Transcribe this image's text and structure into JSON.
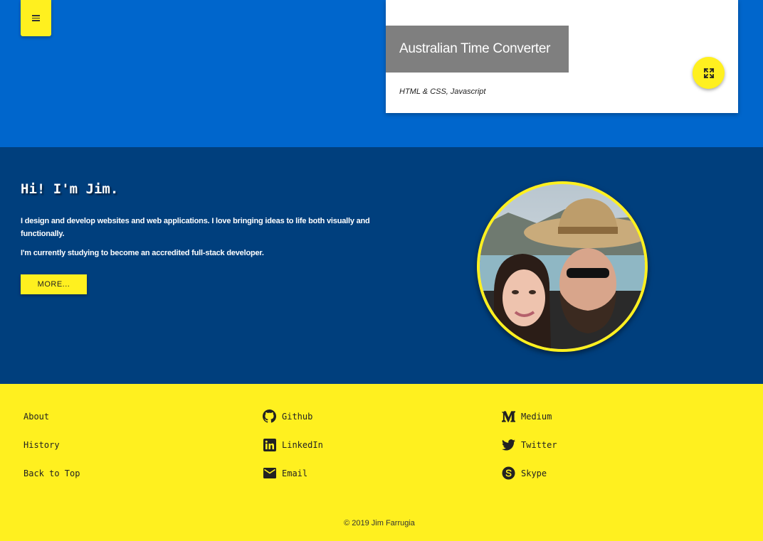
{
  "nav": {
    "menu_icon": "hamburger-menu-icon"
  },
  "project": {
    "title": "Australian Time Converter",
    "tags": "HTML & CSS, Javascript",
    "expand_icon": "fullscreen-expand-icon"
  },
  "about": {
    "heading": "Hi! I'm Jim.",
    "paragraph1": "I design and develop websites and web applications. I love bringing ideas to life both visually and functionally.",
    "paragraph2": "I'm currently studying to become an accredited full-stack developer.",
    "more_label": "MORE...",
    "photo_icon": "profile-photo"
  },
  "footer": {
    "col1": [
      {
        "label": "About"
      },
      {
        "label": "History"
      },
      {
        "label": "Back to Top"
      }
    ],
    "col2": [
      {
        "label": "Github",
        "icon": "github-icon"
      },
      {
        "label": "LinkedIn",
        "icon": "linkedin-icon"
      },
      {
        "label": "Email",
        "icon": "email-icon"
      }
    ],
    "col3": [
      {
        "label": "Medium",
        "icon": "medium-icon"
      },
      {
        "label": "Twitter",
        "icon": "twitter-icon"
      },
      {
        "label": "Skype",
        "icon": "skype-icon"
      }
    ],
    "copyright": "© 2019 Jim Farrugia"
  },
  "colors": {
    "primary_blue": "#0066cc",
    "dark_blue": "#003f7d",
    "accent_yellow": "#fff01f",
    "card_title_gray": "#7f7f7f"
  }
}
